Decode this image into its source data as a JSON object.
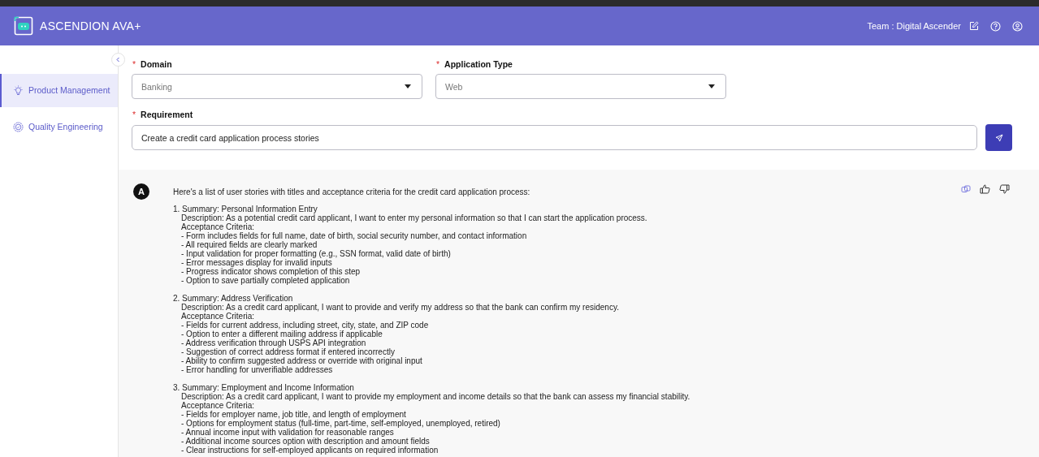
{
  "header": {
    "brand": "ASCENDION AVA+",
    "team": "Team : Digital Ascender"
  },
  "sidebar": {
    "items": [
      {
        "label": "Product Management",
        "kind": "bulb",
        "selected": true
      },
      {
        "label": "Quality Engineering",
        "kind": "badge",
        "selected": false
      }
    ]
  },
  "form": {
    "domain": {
      "label": "Domain",
      "required_mark": "*",
      "value": "Banking"
    },
    "application_type": {
      "label": "Application Type",
      "required_mark": "*",
      "value": "Web"
    },
    "requirement": {
      "label": "Requirement",
      "required_mark": "*",
      "value": "Create a credit card application process stories"
    }
  },
  "response": {
    "avatar": "A",
    "intro": "Here's a list of user stories with titles and acceptance criteria for the credit card application process:",
    "stories": [
      {
        "title": "1. Summary: Personal Information Entry",
        "description": "Description: As a potential credit card applicant, I want to enter my personal information so that I can start the application process.",
        "criteria_label": "Acceptance Criteria:",
        "criteria": [
          "- Form includes fields for full name, date of birth, social security number, and contact information",
          "- All required fields are clearly marked",
          "- Input validation for proper formatting (e.g., SSN format, valid date of birth)",
          "- Error messages display for invalid inputs",
          "- Progress indicator shows completion of this step",
          "- Option to save partially completed application"
        ]
      },
      {
        "title": "2. Summary: Address Verification",
        "description": "Description: As a credit card applicant, I want to provide and verify my address so that the bank can confirm my residency.",
        "criteria_label": "Acceptance Criteria:",
        "criteria": [
          "- Fields for current address, including street, city, state, and ZIP code",
          "- Option to enter a different mailing address if applicable",
          "- Address verification through USPS API integration",
          "- Suggestion of correct address format if entered incorrectly",
          "- Ability to confirm suggested address or override with original input",
          "- Error handling for unverifiable addresses"
        ]
      },
      {
        "title": "3. Summary: Employment and Income Information",
        "description": "Description: As a credit card applicant, I want to provide my employment and income details so that the bank can assess my financial stability.",
        "criteria_label": "Acceptance Criteria:",
        "criteria": [
          "- Fields for employer name, job title, and length of employment",
          "- Options for employment status (full-time, part-time, self-employed, unemployed, retired)",
          "- Annual income input with validation for reasonable ranges",
          "- Additional income sources option with description and amount fields",
          "- Clear instructions for self-employed applicants on required information"
        ]
      }
    ]
  }
}
